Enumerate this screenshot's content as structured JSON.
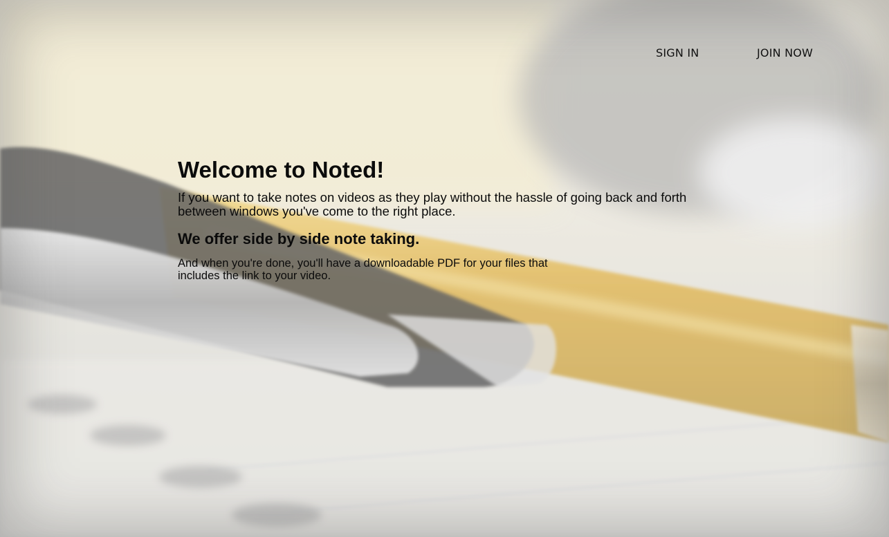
{
  "nav": {
    "sign_in": "SIGN IN",
    "join_now": "JOIN NOW"
  },
  "hero": {
    "title": "Welcome to Noted!",
    "lead": "If you want to take notes on videos as they play without the hassle of going back and forth between windows you've come to the right place.",
    "subtitle": "We offer side by side note taking.",
    "detail": "And when you're done, you'll have a downloadable PDF for your files that includes the link to your video."
  },
  "background": {
    "image": "blurred-yellow-pen-on-notebook",
    "colors": {
      "pen_body": "#d9a92e",
      "pen_clip": "#2b2b2b",
      "chrome": "#cfcfcf",
      "paper": "#e8e6e0"
    }
  }
}
